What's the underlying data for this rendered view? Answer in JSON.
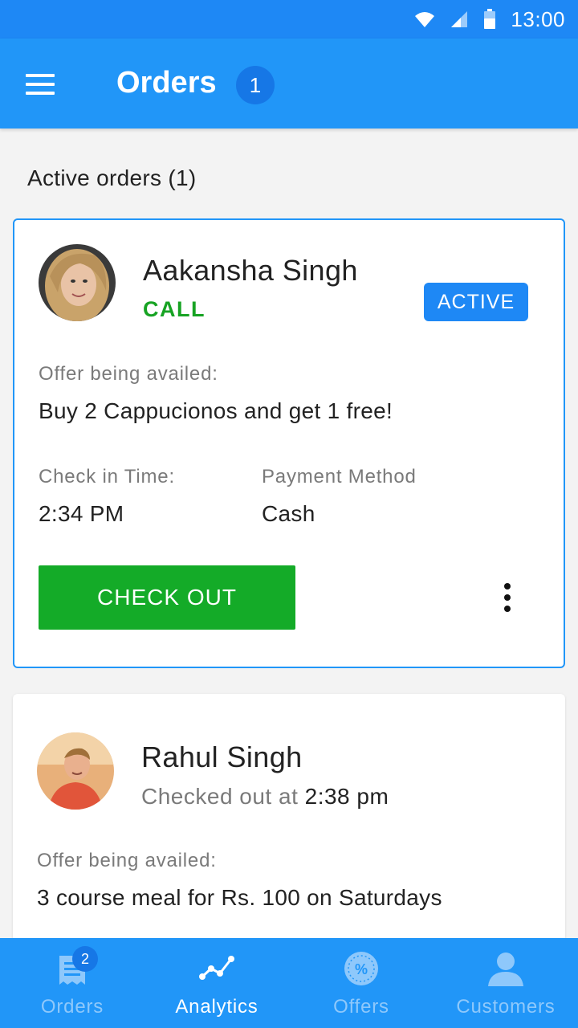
{
  "status_bar": {
    "time": "13:00",
    "icons": [
      "wifi-icon",
      "signal-icon",
      "battery-icon"
    ]
  },
  "app_bar": {
    "title": "Orders",
    "count_badge": "1",
    "menu_icon": "hamburger-icon"
  },
  "section": {
    "heading": "Active orders (1)"
  },
  "orders": [
    {
      "name": "Aakansha Singh",
      "call_label": "CALL",
      "status": "ACTIVE",
      "offer_label": "Offer being availed:",
      "offer": "Buy 2 Cappucionos and get 1 free!",
      "checkin_label": "Check in Time:",
      "checkin_time": "2:34 PM",
      "payment_label": "Payment Method",
      "payment_method": "Cash",
      "checkout_label": "CHECK OUT"
    },
    {
      "name": "Rahul Singh",
      "checked_out_prefix": "Checked out at",
      "checked_out_time": "2:38 pm",
      "offer_label": "Offer being availed:",
      "offer": "3 course meal for Rs. 100 on Saturdays"
    }
  ],
  "bottom_nav": {
    "items": [
      {
        "label": "Orders",
        "icon": "receipt-icon",
        "badge": "2",
        "selected": false
      },
      {
        "label": "Analytics",
        "icon": "analytics-icon",
        "selected": true
      },
      {
        "label": "Offers",
        "icon": "offer-percent-icon",
        "selected": false
      },
      {
        "label": "Customers",
        "icon": "customer-icon",
        "selected": false
      }
    ]
  },
  "colors": {
    "primary": "#2196f8",
    "status_bar": "#1e88f5",
    "call_green": "#17a323",
    "checkout_green": "#14ab28",
    "active_badge": "#1e88f5",
    "nav_inactive": "#8ec8fb"
  }
}
